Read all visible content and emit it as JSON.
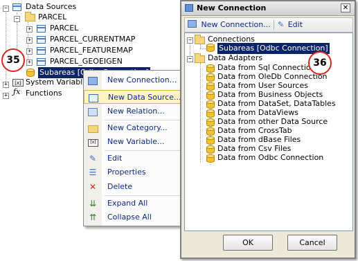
{
  "tree": {
    "root_label": "Data Sources",
    "parcel_label": "PARCEL",
    "children": [
      "PARCEL",
      "PARCEL_CURRENTMAP",
      "PARCEL_FEATUREMAP",
      "PARCEL_GEOEIGEN"
    ],
    "selected_item": "Subareas [Odbc Connection]",
    "system_variables": "System Variables",
    "functions": "Functions",
    "expand_glyph": "+",
    "collapse_glyph": "−"
  },
  "badges": {
    "left": "35",
    "right": "36"
  },
  "context_menu": {
    "items": [
      {
        "label": "New Connection...",
        "icon": "new-connection-icon"
      },
      {
        "label": "New Data Source...",
        "icon": "new-data-source-icon"
      },
      {
        "label": "New Relation...",
        "icon": "new-relation-icon"
      },
      {
        "label": "New Category...",
        "icon": "new-category-icon"
      },
      {
        "label": "New Variable...",
        "icon": "new-variable-icon"
      },
      {
        "label": "Edit",
        "icon": "edit-icon"
      },
      {
        "label": "Properties",
        "icon": "properties-icon"
      },
      {
        "label": "Delete",
        "icon": "delete-icon"
      },
      {
        "label": "Expand All",
        "icon": "expand-all-icon"
      },
      {
        "label": "Collapse All",
        "icon": "collapse-all-icon"
      }
    ],
    "hover_index": 1
  },
  "dialog": {
    "title": "New Connection",
    "close_glyph": "✕",
    "toolbar": {
      "new_connection": "New Connection...",
      "edit": "Edit"
    },
    "connections_label": "Connections",
    "selected_connection": "Subareas [Odbc Connection]",
    "data_adapters_label": "Data Adapters",
    "adapters": [
      "Data from Sql Connection",
      "Data from OleDb Connection",
      "Data from User Sources",
      "Data from Business Objects",
      "Data from DataSet, DataTables",
      "Data from DataViews",
      "Data from other Data Source",
      "Data from CrossTab",
      "Data from dBase Files",
      "Data from Csv Files",
      "Data from Odbc Connection"
    ],
    "ok": "OK",
    "cancel": "Cancel"
  },
  "colors": {
    "selection": "#0a246a",
    "badge_border": "#d8241c",
    "menu_text": "#0a2a87"
  }
}
